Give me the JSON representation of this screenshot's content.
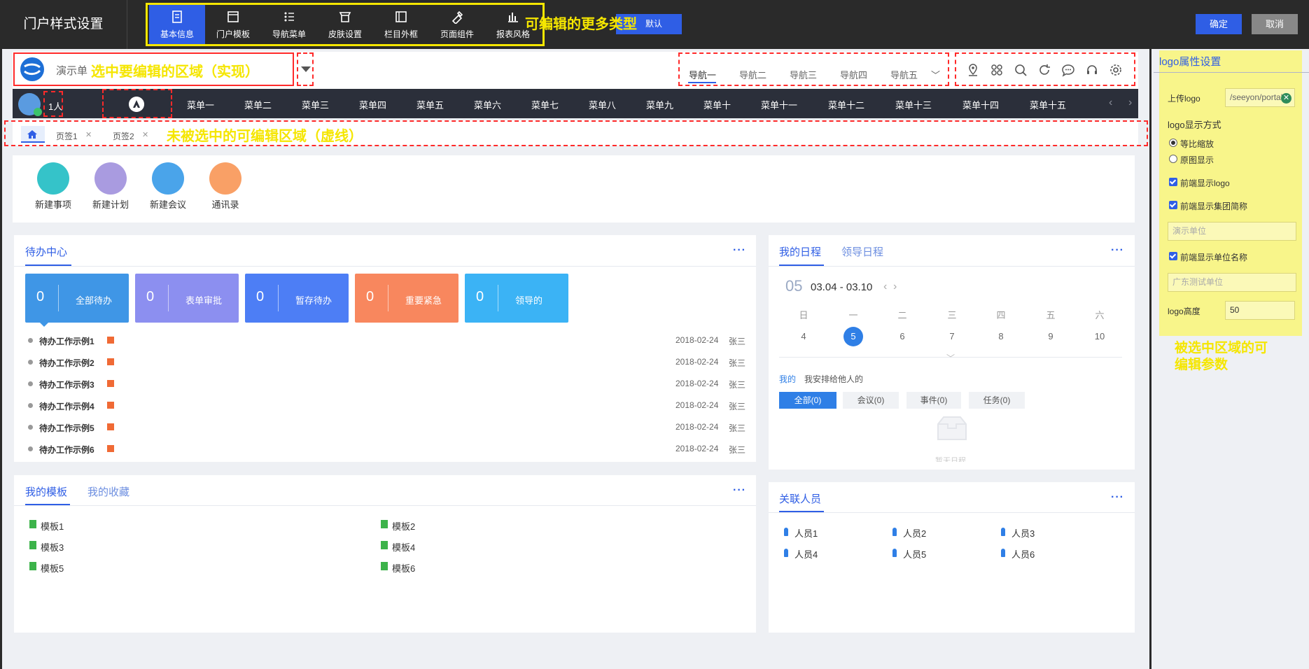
{
  "app": {
    "title": "门户样式设置",
    "ok_label": "确定",
    "cancel_label": "取消",
    "restore_label": "默认"
  },
  "toolbar": {
    "items": [
      {
        "label": "基本信息",
        "icon": "book-icon",
        "active": true
      },
      {
        "label": "门户模板",
        "icon": "window-icon"
      },
      {
        "label": "导航菜单",
        "icon": "list-icon"
      },
      {
        "label": "皮肤设置",
        "icon": "shirt-icon"
      },
      {
        "label": "栏目外框",
        "icon": "frame-icon"
      },
      {
        "label": "页面组件",
        "icon": "puzzle-icon"
      },
      {
        "label": "报表风格",
        "icon": "bar-chart-icon"
      }
    ]
  },
  "annotations": {
    "more_types": "可编辑的更多类型",
    "selected_area": "选中要编辑的区域（实现）",
    "unselected_area": "未被选中的可编辑区域（虚线）",
    "selected_params_line1": "被选中区域的可",
    "selected_params_line2": "编辑参数"
  },
  "header": {
    "org_name": "演示单",
    "top_nav": [
      "导航一",
      "导航二",
      "导航三",
      "导航四",
      "导航五"
    ],
    "icons": [
      "location-icon",
      "apps-icon",
      "search-icon",
      "refresh-icon",
      "chat-icon",
      "headset-icon",
      "gear-icon"
    ]
  },
  "menubar": {
    "online_count": "1人",
    "menus": [
      "菜单一",
      "菜单二",
      "菜单三",
      "菜单四",
      "菜单五",
      "菜单六",
      "菜单七",
      "菜单八",
      "菜单九",
      "菜单十",
      "菜单十一",
      "菜单十二",
      "菜单十三",
      "菜单十四",
      "菜单十五"
    ]
  },
  "tabs": [
    {
      "label": "页签1"
    },
    {
      "label": "页签2"
    }
  ],
  "quick_actions": [
    {
      "label": "新建事项",
      "color": "#35c3c9"
    },
    {
      "label": "新建计划",
      "color": "#a99be0"
    },
    {
      "label": "新建会议",
      "color": "#4aa4ea"
    },
    {
      "label": "通讯录",
      "color": "#f9a066"
    }
  ],
  "todo": {
    "title": "待办中心",
    "tiles": [
      {
        "count": "0",
        "label": "全部待办",
        "color": "#3f96e6"
      },
      {
        "count": "0",
        "label": "表单审批",
        "color": "#8c8ff0"
      },
      {
        "count": "0",
        "label": "暂存待办",
        "color": "#4d7ef5"
      },
      {
        "count": "0",
        "label": "重要紧急",
        "color": "#f8875e"
      },
      {
        "count": "0",
        "label": "领导的",
        "color": "#3bb3f5"
      }
    ],
    "items": [
      {
        "title": "待办工作示例1",
        "date": "2018-02-24",
        "user": "张三"
      },
      {
        "title": "待办工作示例2",
        "date": "2018-02-24",
        "user": "张三"
      },
      {
        "title": "待办工作示例3",
        "date": "2018-02-24",
        "user": "张三"
      },
      {
        "title": "待办工作示例4",
        "date": "2018-02-24",
        "user": "张三"
      },
      {
        "title": "待办工作示例5",
        "date": "2018-02-24",
        "user": "张三"
      },
      {
        "title": "待办工作示例6",
        "date": "2018-02-24",
        "user": "张三"
      }
    ]
  },
  "schedule": {
    "tab_active": "我的日程",
    "tab_other": "领导日程",
    "month": "05",
    "range": "03.04 - 03.10",
    "weekdays": [
      "日",
      "一",
      "二",
      "三",
      "四",
      "五",
      "六"
    ],
    "days": [
      "4",
      "5",
      "6",
      "7",
      "8",
      "9",
      "10"
    ],
    "owner_mine": "我的",
    "owner_others": "我安排给他人的",
    "filters": [
      "全部(0)",
      "会议(0)",
      "事件(0)",
      "任务(0)"
    ],
    "empty_text": "暂无日程"
  },
  "templates": {
    "tab_active": "我的模板",
    "tab_other": "我的收藏",
    "items": [
      "模板1",
      "模板2",
      "模板3",
      "模板4",
      "模板5",
      "模板6"
    ]
  },
  "people": {
    "title": "关联人员",
    "items": [
      "人员1",
      "人员2",
      "人员3",
      "人员4",
      "人员5",
      "人员6"
    ]
  },
  "props": {
    "title": "logo属性设置",
    "upload_label": "上传logo",
    "upload_value": "/seeyon/portal",
    "display_mode_label": "logo显示方式",
    "mode_scale": "等比缩放",
    "mode_original": "原图显示",
    "show_logo": "前端显示logo",
    "show_group": "前端显示集团简称",
    "group_placeholder": "演示单位",
    "show_unit": "前端显示单位名称",
    "unit_placeholder": "广东测试单位",
    "height_label": "logo高度",
    "height_value": "50"
  }
}
